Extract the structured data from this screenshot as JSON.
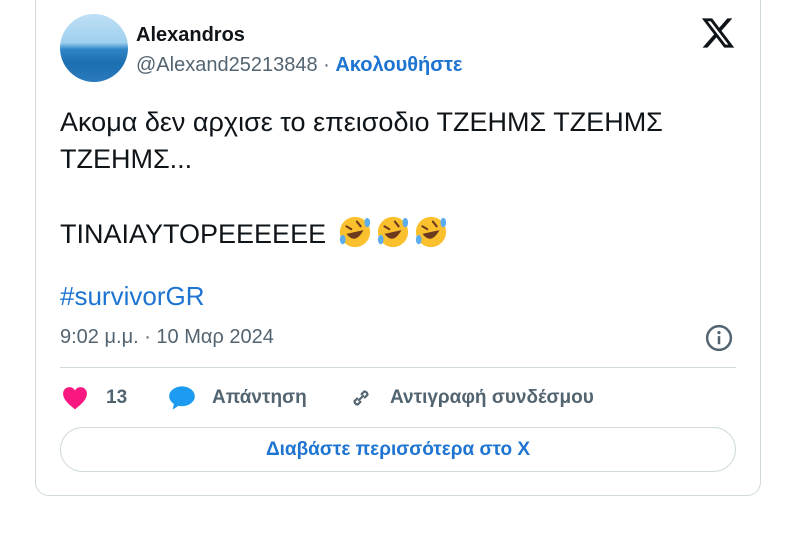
{
  "author": {
    "name": "Alexandros",
    "handle": "@Alexand25213848",
    "separator": "·",
    "follow_label": "Ακολουθήστε"
  },
  "tweet": {
    "line1": "Ακομα δεν αρχισε το επεισοδιο ΤΖΕΗΜΣ ΤΖΕΗΜΣ ΤΖΕΗΜΣ...",
    "line2": "ΤΙΝΑΙΑΥΤΟΡΕΕΕΕΕΕ",
    "emoji": [
      "rolling-on-floor-laughing",
      "rolling-on-floor-laughing",
      "rolling-on-floor-laughing"
    ],
    "hashtag": "#survivorGR",
    "timestamp": "9:02 μ.μ. · 10 Μαρ 2024"
  },
  "actions": {
    "like_count": "13",
    "reply_label": "Απάντηση",
    "copy_link_label": "Αντιγραφή συνδέσμου"
  },
  "read_more_label": "Διαβάστε περισσότερα στο X",
  "colors": {
    "accent": "#1d74d1",
    "heart": "#f91880",
    "muted_text": "#536471",
    "border": "#cfd9de"
  },
  "icons": [
    "x-logo-icon",
    "info-icon",
    "heart-icon",
    "reply-bubble-icon",
    "link-icon"
  ]
}
